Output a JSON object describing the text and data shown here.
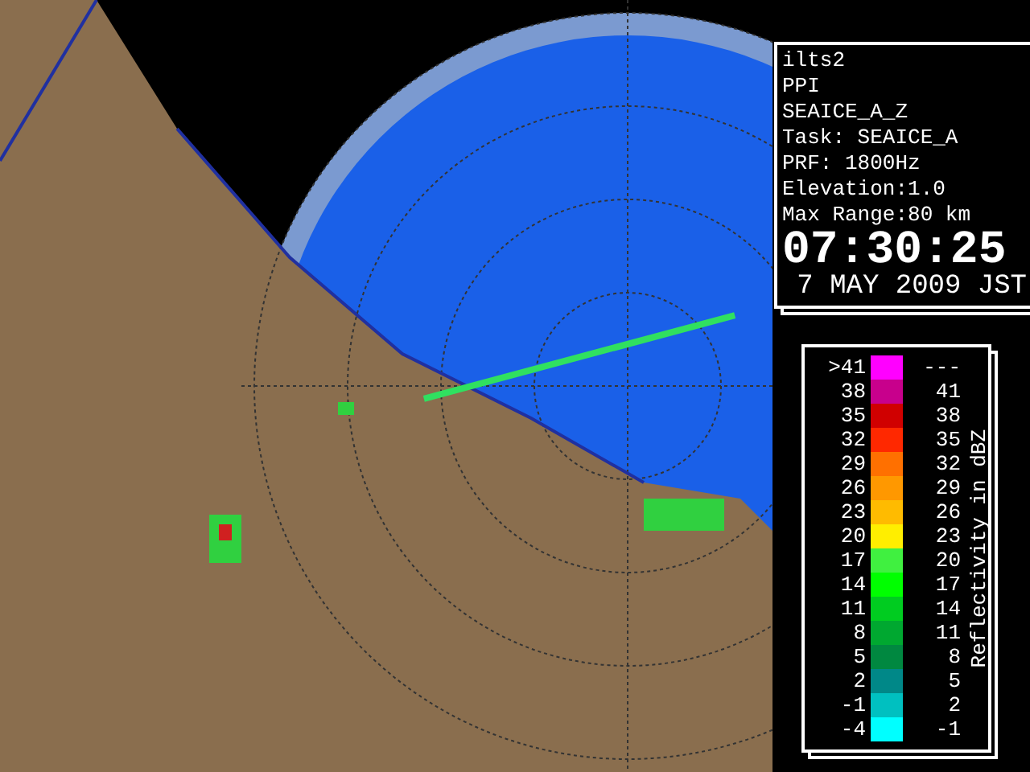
{
  "radar_info": {
    "lines": [
      "ilts2",
      "PPI",
      "SEAICE_A_Z",
      "Task: SEAICE_A",
      "PRF: 1800Hz",
      "Elevation:1.0",
      "Max Range:80 km"
    ],
    "time": "07:30:25",
    "date": "7 MAY 2009 JST"
  },
  "legend": {
    "title": "Reflectivity in dBZ",
    "rows": [
      {
        "low": ">41",
        "high": "---",
        "color": "#ff00ff"
      },
      {
        "low": "38",
        "high": "41",
        "color": "#c8008c"
      },
      {
        "low": "35",
        "high": "38",
        "color": "#d00000"
      },
      {
        "low": "32",
        "high": "35",
        "color": "#ff2800"
      },
      {
        "low": "29",
        "high": "32",
        "color": "#ff7000"
      },
      {
        "low": "26",
        "high": "29",
        "color": "#ff9800"
      },
      {
        "low": "23",
        "high": "26",
        "color": "#ffbb00"
      },
      {
        "low": "20",
        "high": "23",
        "color": "#ffee00"
      },
      {
        "low": "17",
        "high": "20",
        "color": "#40f040"
      },
      {
        "low": "14",
        "high": "17",
        "color": "#00ff00"
      },
      {
        "low": "11",
        "high": "14",
        "color": "#00cc20"
      },
      {
        "low": "8",
        "high": "11",
        "color": "#00a830"
      },
      {
        "low": "5",
        "high": "8",
        "color": "#008840"
      },
      {
        "low": "2",
        "high": "5",
        "color": "#008888"
      },
      {
        "low": "-1",
        "high": "2",
        "color": "#00c0c0"
      },
      {
        "low": "-4",
        "high": "-1",
        "color": "#00ffff"
      }
    ]
  }
}
